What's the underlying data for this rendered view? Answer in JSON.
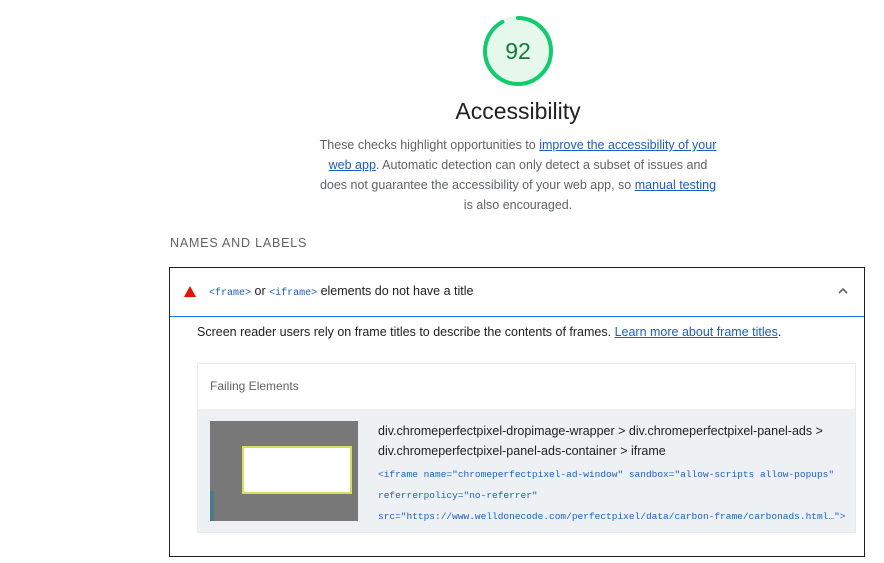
{
  "score": {
    "value": "92",
    "fraction": 0.92,
    "color": "#0cce6b"
  },
  "category": {
    "title": "Accessibility",
    "desc_part1": "These checks highlight opportunities to ",
    "link1": "improve the accessibility of your web app",
    "desc_part2": ". Automatic detection can only detect a subset of issues and does not guarantee the accessibility of your web app, so ",
    "link2": "manual testing",
    "desc_part3": " is also encouraged."
  },
  "group": {
    "title": "NAMES AND LABELS"
  },
  "audit": {
    "icon": "fail-triangle-icon",
    "code1": "<frame>",
    "or_text": " or ",
    "code2": "<iframe>",
    "title_rest": " elements do not have a title",
    "chevron_icon": "chevron-up-icon",
    "desc": "Screen reader users rely on frame titles to describe the contents of frames. ",
    "learn_more": "Learn more about frame titles",
    "desc_end": ".",
    "details_header": "Failing Elements",
    "items": [
      {
        "selector": "div.chromeperfectpixel-dropimage-wrapper > div.chromeperfectpixel-panel-ads > div.chromeperfectpixel-panel-ads-container > iframe",
        "snippet_line1": "<iframe name=\"chromeperfectpixel-ad-window\" sandbox=\"allow-scripts allow-popups\"",
        "snippet_line2": "referrerpolicy=\"no-referrer\"",
        "snippet_line3": "src=\"https://www.welldonecode.com/perfectpixel/data/carbon-frame/carbonads.html…\">"
      }
    ]
  }
}
